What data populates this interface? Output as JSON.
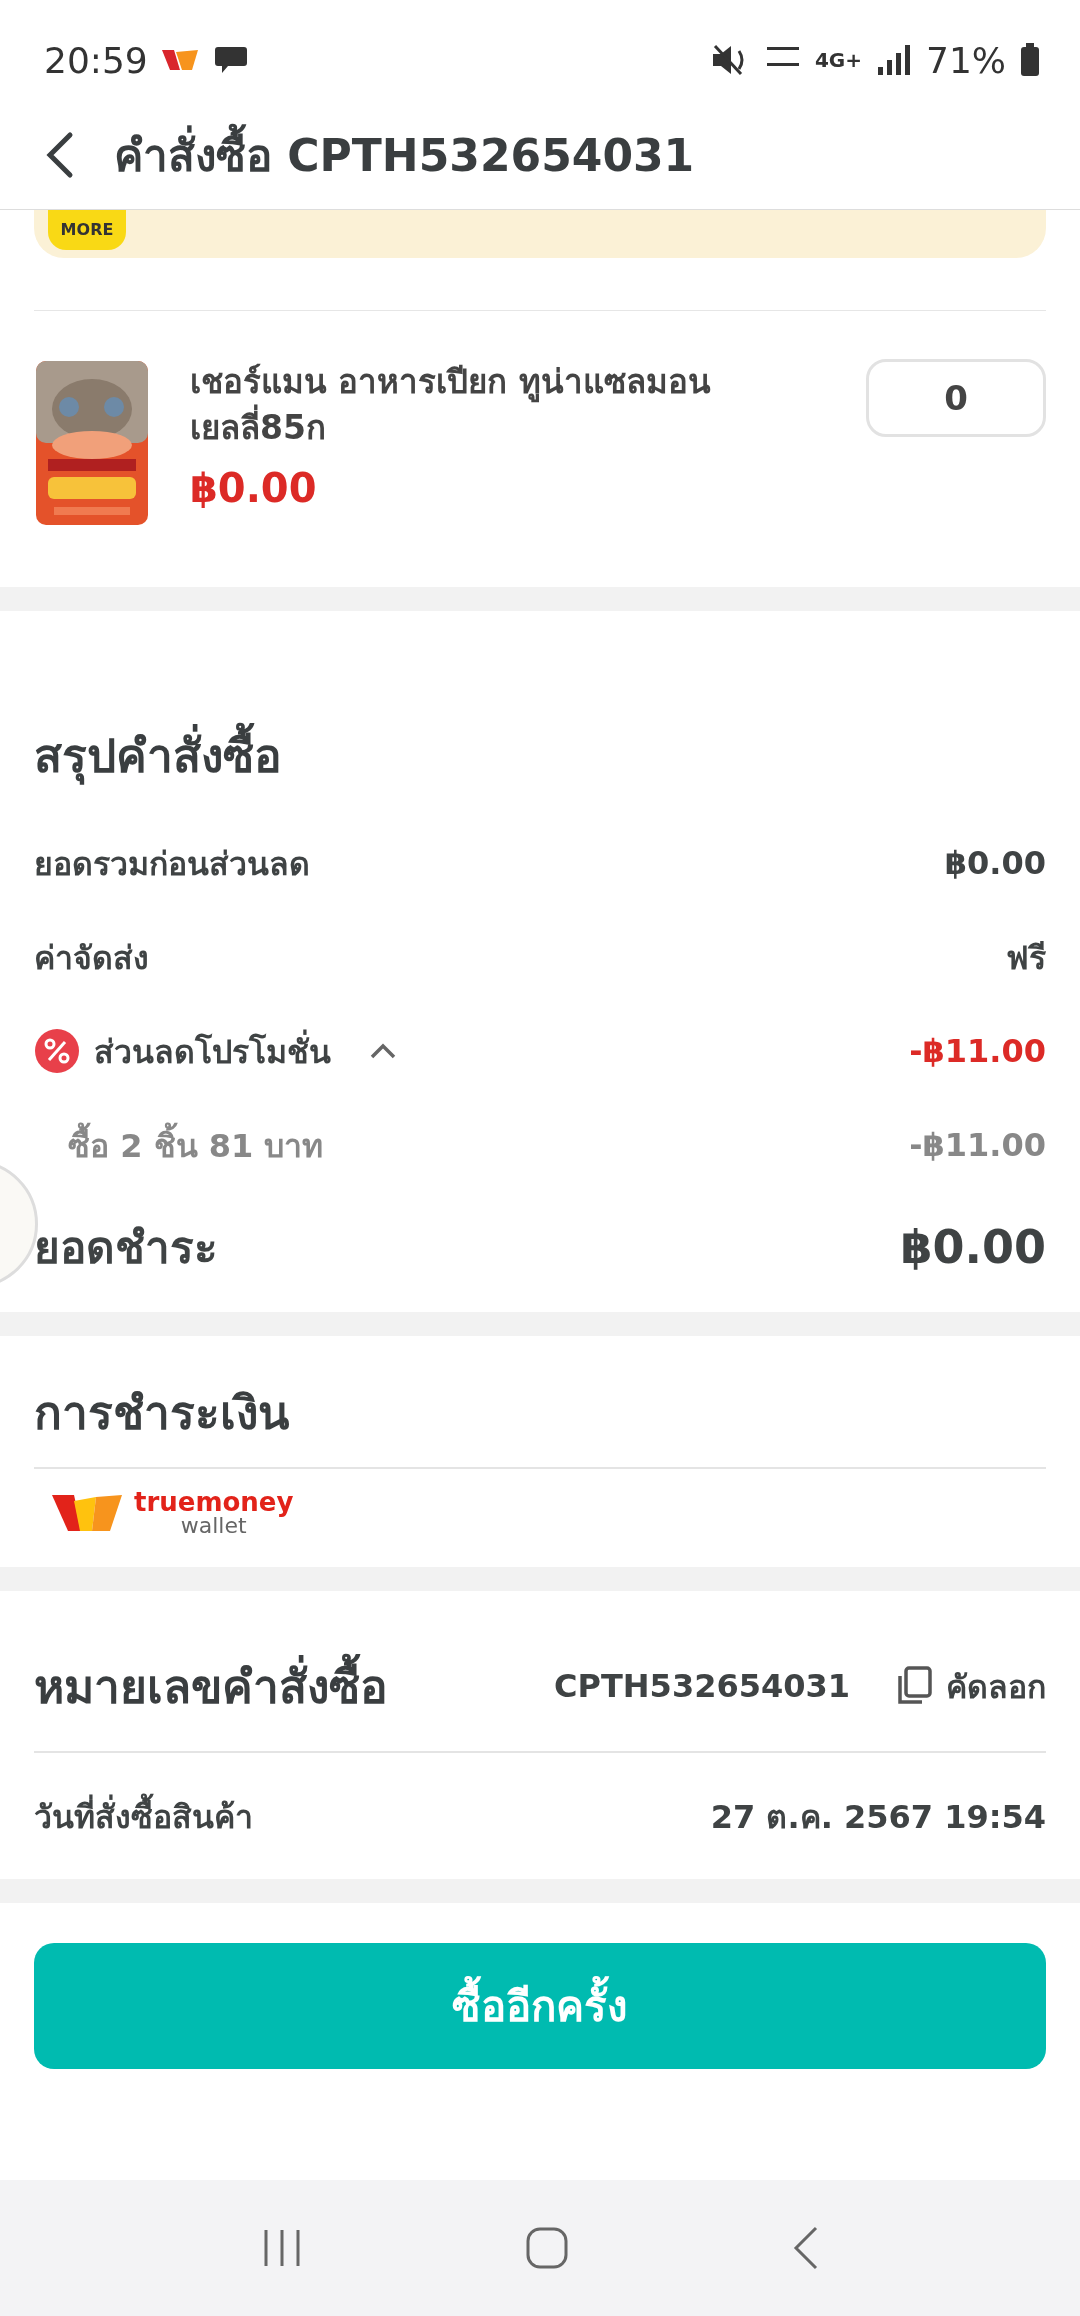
{
  "status_bar": {
    "time": "20:59",
    "battery": "71%",
    "network": "4G+"
  },
  "header": {
    "title": "คำสั่งซื้อ CPTH532654031"
  },
  "promo_banner": {
    "badge": "MORE"
  },
  "product": {
    "name": "เชอร์แมน อาหารเปียก ทูน่าแซลมอน เยลลี่85ก",
    "price": "฿0.00",
    "quantity": "0"
  },
  "summary": {
    "title": "สรุปคำสั่งซื้อ",
    "rows": [
      {
        "kind": "plain",
        "label": "ยอดรวมก่อนส่วนลด",
        "value": "฿0.00"
      },
      {
        "kind": "plain",
        "label": "ค่าจัดส่ง",
        "value": "ฟรี"
      },
      {
        "kind": "promo",
        "label": "ส่วนลดโปรโมชั่น",
        "value": "-฿11.00",
        "expanded": true
      },
      {
        "kind": "sub",
        "label": "ซื้อ 2 ชิ้น 81 บาท",
        "value": "-฿11.00"
      }
    ],
    "total_label": "ยอดชำระ",
    "total_value": "฿0.00"
  },
  "payment": {
    "title": "การชำระเงิน",
    "method_brand": "truemoney",
    "method_sub": "wallet"
  },
  "order_info": {
    "number_label": "หมายเลขคำสั่งซื้อ",
    "number": "CPTH532654031",
    "copy_label": "คัดลอก",
    "date_label": "วันที่สั่งซื้อสินค้า",
    "date": "27 ต.ค. 2567 19:54"
  },
  "reorder_button": "ซื้ออีกครั้ง"
}
